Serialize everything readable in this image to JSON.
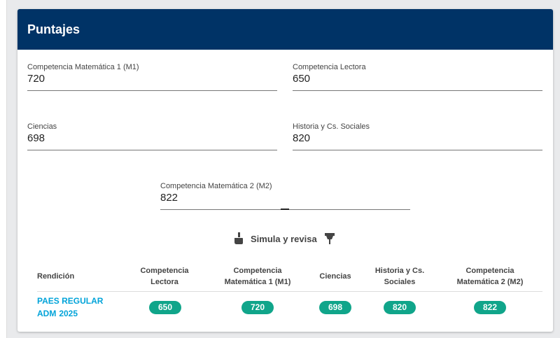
{
  "card": {
    "title": "Puntajes"
  },
  "fields": {
    "m1": {
      "label": "Competencia Matemática 1 (M1)",
      "value": "720"
    },
    "lectora": {
      "label": "Competencia Lectora",
      "value": "650"
    },
    "ciencias": {
      "label": "Ciencias",
      "value": "698"
    },
    "historia": {
      "label": "Historia y Cs. Sociales",
      "value": "820"
    },
    "m2": {
      "label": "Competencia Matemática 2 (M2)",
      "value": "822"
    }
  },
  "simula": {
    "label": "Simula y revisa",
    "icons": [
      "thumb-down-icon",
      "pin-icon"
    ]
  },
  "table": {
    "headers": {
      "rendicion": "Rendición",
      "lectora_1": "Competencia",
      "lectora_2": "Lectora",
      "m1_1": "Competencia",
      "m1_2": "Matemática 1 (M1)",
      "ciencias": "Ciencias",
      "historia_1": "Historia y Cs.",
      "historia_2": "Sociales",
      "m2_1": "Competencia",
      "m2_2": "Matemática 2 (M2)"
    },
    "row": {
      "rendicion_1": "PAES REGULAR",
      "rendicion_2": "ADM",
      "year": "2025",
      "lectora": "650",
      "m1": "720",
      "ciencias": "698",
      "historia": "820",
      "m2": "822"
    }
  },
  "colors": {
    "header_bg": "#003366",
    "pill_bg": "#10a58a",
    "link": "#00a3d9"
  }
}
